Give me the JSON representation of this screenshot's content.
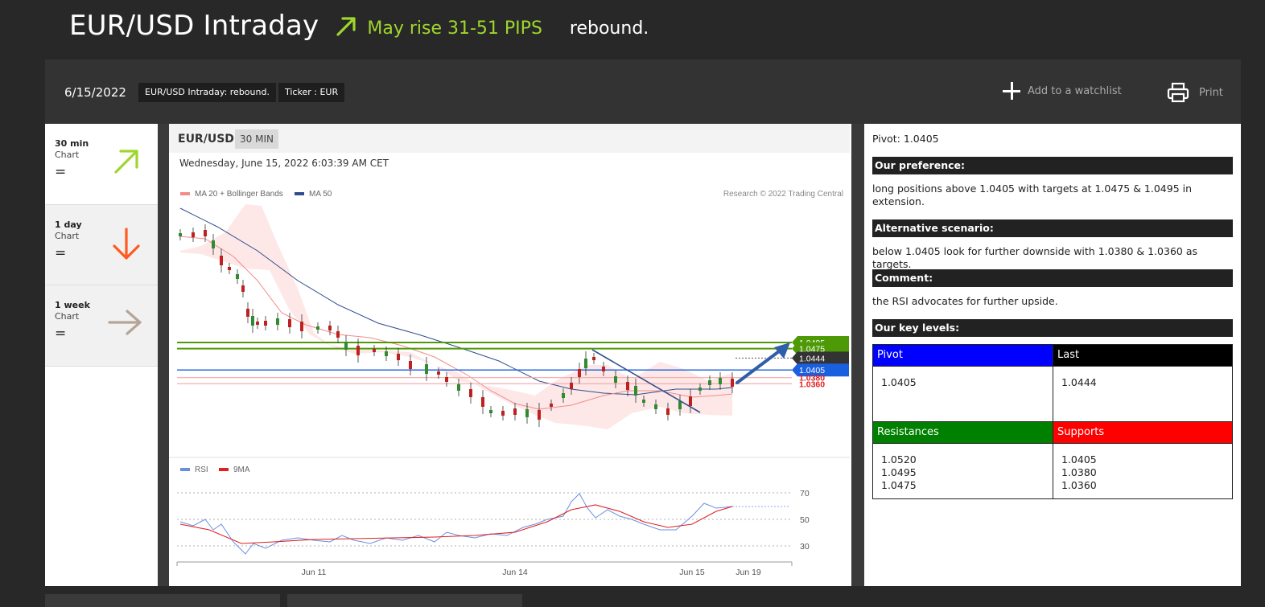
{
  "header": {
    "title": "EUR/USD Intraday",
    "forecast": "May rise 31-51 PIPS",
    "keyword": "rebound.",
    "accent_color": "#9fd62c"
  },
  "topbar": {
    "date": "6/15/2022",
    "chip_title": "EUR/USD Intraday: rebound.",
    "chip_ticker": "Ticker : EUR",
    "watchlist_label": "Add to a watchlist",
    "print_label": "Print"
  },
  "timeframes": [
    {
      "label": "30 min",
      "sub": "Chart",
      "trend": "=",
      "direction": "up",
      "icon": "arrow-up-right-icon"
    },
    {
      "label": "1 day",
      "sub": "Chart",
      "trend": "=",
      "direction": "down",
      "icon": "arrow-down-icon"
    },
    {
      "label": "1 week",
      "sub": "Chart",
      "trend": "=",
      "direction": "right",
      "icon": "arrow-right-icon"
    }
  ],
  "chart": {
    "symbol": "EUR/USD",
    "timeframe": "30 MIN",
    "datetime": "Wednesday, June 15, 2022 6:03:39 AM CET",
    "legend_ma20": "MA 20 + Bollinger Bands",
    "legend_ma50": "MA 50",
    "credit": "Research © 2022 Trading Central",
    "rsi_legend": "RSI",
    "rsi_ma_legend": "9MA",
    "x_labels": [
      "Jun 11",
      "Jun 14",
      "Jun 15",
      "Jun 19"
    ],
    "rsi_levels": [
      "70",
      "50",
      "30"
    ],
    "levels": [
      {
        "value": "1.0495",
        "kind": "resistance",
        "color": "#4e9a06"
      },
      {
        "value": "1.0475",
        "kind": "resistance",
        "color": "#4e9a06"
      },
      {
        "value": "1.0444",
        "kind": "last",
        "color": "#333333"
      },
      {
        "value": "1.0405",
        "kind": "pivot",
        "color": "#1a5fe0"
      },
      {
        "value": "1.0380",
        "kind": "support",
        "color": "#e02020"
      },
      {
        "value": "1.0360",
        "kind": "support",
        "color": "#e02020"
      }
    ]
  },
  "analysis": {
    "pivot_line": "Pivot: 1.0405",
    "preference_title": "Our preference:",
    "preference_text": "long positions above 1.0405 with targets at 1.0475 & 1.0495 in extension.",
    "alternative_title": "Alternative scenario:",
    "alternative_text": "below 1.0405 look for further downside with 1.0380 & 1.0360 as targets.",
    "comment_title": "Comment:",
    "comment_text": "the RSI advocates for further upside.",
    "key_levels_title": "Our key levels:",
    "pivot_header": "Pivot",
    "pivot_value": "1.0405",
    "last_header": "Last",
    "last_value": "1.0444",
    "resistances_header": "Resistances",
    "resistances": [
      "1.0520",
      "1.0495",
      "1.0475"
    ],
    "supports_header": "Supports",
    "supports": [
      "1.0405",
      "1.0380",
      "1.0360"
    ],
    "pivot_color": "#0000ff",
    "last_color": "#000000",
    "resistance_color": "#008000",
    "support_color": "#ff0000"
  }
}
